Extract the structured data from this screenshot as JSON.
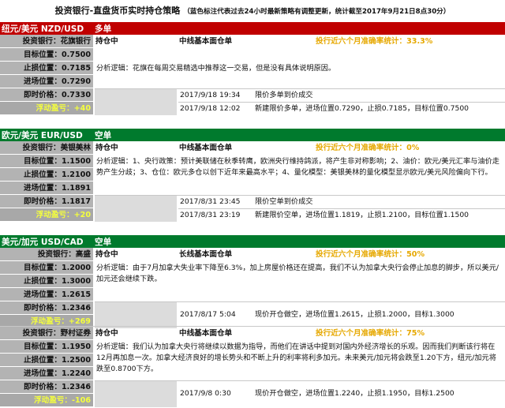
{
  "header": {
    "title": "投资银行-直盘货币实时持仓策略",
    "subtitle": "（蓝色标注代表过去24小时最新策略有调整更新，统计截至2017年9月21日8点30分）"
  },
  "sections": [
    {
      "pair": "纽元/美元 NZD/USD",
      "direction": "多单",
      "color": "red",
      "bank_label": "投资银行：花旗银行",
      "status": "持仓中",
      "strategy_type": "中线基本面仓单",
      "accuracy": "投行近六个月准确率统计：33.3%",
      "target_label": "目标位置：0.7500",
      "stop_label": "止损位置：0.7185",
      "entry_label": "进场位置：0.7290",
      "logic": "分析逻辑：花旗在每周交易精选中推荐这一交易，但是没有具体说明原因。",
      "current_label": "即时价格：0.7330",
      "float_label": "浮动盈亏：+40",
      "log": [
        {
          "date": "2017/9/18 19:34",
          "note": "限价多单到价成交"
        },
        {
          "date": "2017/9/18 12:02",
          "note": "新建限价多单，进场位置0.7290，止损0.7185，目标位置0.7500"
        }
      ]
    },
    {
      "pair": "欧元/美元 EUR/USD",
      "direction": "空单",
      "color": "green",
      "bank_label": "投资银行：美银美林",
      "status": "持仓中",
      "strategy_type": "中线基本面仓单",
      "accuracy": "投行近六个月准确率统计：0%",
      "target_label": "目标位置：1.1500",
      "stop_label": "止损位置：1.2100",
      "entry_label": "进场位置：1.1891",
      "logic": "分析逻辑：1、央行政策：预计美联储在秋季转鹰，欧洲央行维持鸽派，将产生非对称影响；2、油价：欧元/美元汇率与油价走势产生分歧；3、仓位：欧元多仓以创下近年来最高水平；4、量化模型：美银美林的量化模型显示欧元/美元风险偏向下行。",
      "current_label": "即时价格：1.1817",
      "float_label": "浮动盈亏：+20",
      "log": [
        {
          "date": "2017/8/31 23:45",
          "note": "限价空单到价成交"
        },
        {
          "date": "2017/8/31 23:19",
          "note": "新建限价空单，进场位置1.1819，止损1.2100，目标位置1.1500"
        }
      ]
    },
    {
      "pair": "美元/加元 USD/CAD",
      "direction": "空单",
      "color": "green",
      "bank_label": "投资银行：高盛",
      "status": "持仓中",
      "strategy_type": "长线基本面仓单",
      "accuracy": "投行近六个月准确率统计：50%",
      "target_label": "目标位置：1.2000",
      "stop_label": "止损位置：1.3000",
      "entry_label": "进场位置：1.2615",
      "logic": "分析逻辑：由于7月加拿大失业率下降至6.3%，加上房屋价格还在提高，我们不认为加拿大央行会停止加息的脚步，所以美元/加元还会继续下跌。",
      "current_label": "即时价格：1.2346",
      "float_label": "浮动盈亏：+269",
      "log": [
        {
          "date": "2017/8/17 5:04",
          "note": "现价开仓做空，进场位置1.2615，止损1.2000，目标1.3000"
        }
      ]
    },
    {
      "pair": "",
      "direction": "",
      "color": "none",
      "bank_label": "投资银行：野村证券",
      "status": "持仓中",
      "strategy_type": "中线基本面仓单",
      "accuracy": "投行近六个月准确率统计：75%",
      "target_label": "目标位置：1.1950",
      "stop_label": "止损位置：1.2500",
      "entry_label": "进场位置：1.2240",
      "logic": "分析逻辑：我们认为加拿大央行将继续以数据为指导，而他们在讲话中提到对国内外经济增长的乐观。因而我们判断该行将在12月再加息一次。加拿大经济良好的增长势头和不断上升的利率将利多加元。未来美元/加元将会跌至1.20下方，纽元/加元将跌至0.8700下方。",
      "current_label": "即时价格：1.2346",
      "float_label": "浮动盈亏：-106",
      "log": [
        {
          "date": "2017/9/8 0:30",
          "note": "现价开仓做空，进场位置1.2240，止损1.1950，目标1.2500"
        }
      ]
    }
  ]
}
